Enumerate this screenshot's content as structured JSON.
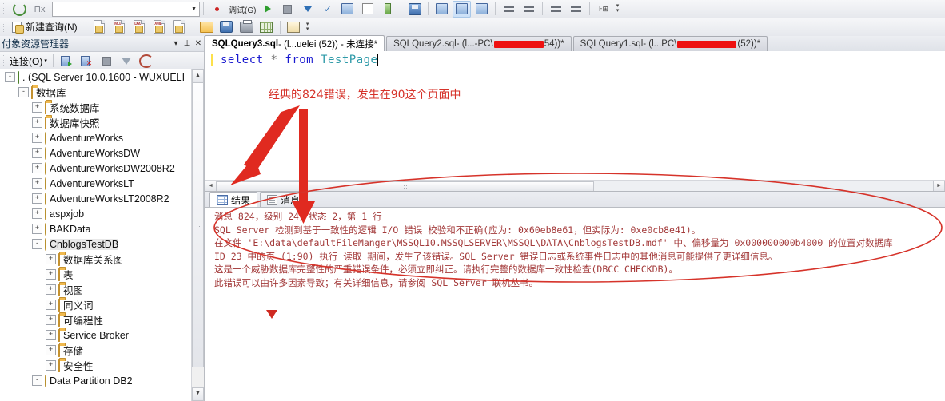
{
  "toolbar_top": {
    "combo_value": "",
    "items": [
      {
        "name": "refresh-icon",
        "glyph": "refresh"
      },
      {
        "name": "debug-stop-icon",
        "glyph": "stop"
      },
      {
        "name": "execute-icon",
        "glyph": "play"
      },
      {
        "name": "check-icon",
        "glyph": "check"
      },
      {
        "name": "plan-icon",
        "glyph": "plan"
      },
      {
        "name": "comment-icon",
        "glyph": "comment"
      },
      {
        "name": "indent-icon",
        "glyph": "indent"
      }
    ]
  },
  "toolbar_main": {
    "new_query_label": "新建查询(N)",
    "buttons": [
      {
        "name": "new-file-button",
        "label": ""
      },
      {
        "name": "new-mdx-query-button",
        "label": "MDX"
      },
      {
        "name": "new-dmx-query-button",
        "label": "DMX"
      },
      {
        "name": "new-xmla-query-button",
        "label": "XML"
      },
      {
        "name": "new-analysis-query-button",
        "label": ""
      },
      {
        "name": "open-file-button",
        "label": ""
      },
      {
        "name": "save-button",
        "label": ""
      },
      {
        "name": "print-button",
        "label": ""
      },
      {
        "name": "query-designer-button",
        "label": ""
      },
      {
        "name": "object-explorer-details-button",
        "label": ""
      }
    ],
    "overflow_label": "▾"
  },
  "explorer": {
    "title": "付象资源管理器",
    "minimize_glyph": "▾",
    "pin_glyph": "⊥",
    "close_glyph": "✕",
    "connect_label": "连接(O)",
    "connect_arrow": "▾",
    "tool_icons": [
      {
        "name": "connect-object-explorer-icon"
      },
      {
        "name": "disconnect-object-explorer-icon"
      },
      {
        "name": "stop-icon"
      },
      {
        "name": "filter-icon"
      },
      {
        "name": "refresh-explorer-icon"
      }
    ],
    "tree": [
      {
        "label": ". (SQL Server 10.0.1600 - WUXUELI",
        "indent": 0,
        "expander": "-",
        "icon": "server-icon",
        "selected": false
      },
      {
        "label": "数据库",
        "indent": 1,
        "expander": "-",
        "icon": "folder-icon",
        "selected": false
      },
      {
        "label": "系统数据库",
        "indent": 2,
        "expander": "+",
        "icon": "folder-icon",
        "selected": false
      },
      {
        "label": "数据库快照",
        "indent": 2,
        "expander": "+",
        "icon": "folder-icon",
        "selected": false
      },
      {
        "label": "AdventureWorks",
        "indent": 2,
        "expander": "+",
        "icon": "database-icon",
        "selected": false
      },
      {
        "label": "AdventureWorksDW",
        "indent": 2,
        "expander": "+",
        "icon": "database-icon",
        "selected": false
      },
      {
        "label": "AdventureWorksDW2008R2",
        "indent": 2,
        "expander": "+",
        "icon": "database-icon",
        "selected": false
      },
      {
        "label": "AdventureWorksLT",
        "indent": 2,
        "expander": "+",
        "icon": "database-icon",
        "selected": false
      },
      {
        "label": "AdventureWorksLT2008R2",
        "indent": 2,
        "expander": "+",
        "icon": "database-icon",
        "selected": false
      },
      {
        "label": "aspxjob",
        "indent": 2,
        "expander": "+",
        "icon": "database-icon",
        "selected": false
      },
      {
        "label": "BAKData",
        "indent": 2,
        "expander": "+",
        "icon": "database-icon",
        "selected": false
      },
      {
        "label": "CnblogsTestDB",
        "indent": 2,
        "expander": "-",
        "icon": "database-icon",
        "selected": true
      },
      {
        "label": "数据库关系图",
        "indent": 3,
        "expander": "+",
        "icon": "folder-icon",
        "selected": false
      },
      {
        "label": "表",
        "indent": 3,
        "expander": "+",
        "icon": "folder-icon",
        "selected": false
      },
      {
        "label": "视图",
        "indent": 3,
        "expander": "+",
        "icon": "folder-icon",
        "selected": false
      },
      {
        "label": "同义词",
        "indent": 3,
        "expander": "+",
        "icon": "folder-icon",
        "selected": false
      },
      {
        "label": "可编程性",
        "indent": 3,
        "expander": "+",
        "icon": "folder-icon",
        "selected": false
      },
      {
        "label": "Service Broker",
        "indent": 3,
        "expander": "+",
        "icon": "folder-icon",
        "selected": false
      },
      {
        "label": "存储",
        "indent": 3,
        "expander": "+",
        "icon": "folder-icon",
        "selected": false
      },
      {
        "label": "安全性",
        "indent": 3,
        "expander": "+",
        "icon": "folder-icon",
        "selected": false
      },
      {
        "label": "Data Partition DB2",
        "indent": 2,
        "expander": "-",
        "icon": "database-icon",
        "selected": false
      }
    ]
  },
  "tabs": [
    {
      "pre": "SQLQuery3.sql",
      "mid": " - (l...uelei (52)) - 未连接*",
      "redact_w": 0,
      "post": "",
      "active": true
    },
    {
      "pre": "SQLQuery2.sql",
      "mid": " - (l...-PC\\",
      "redact_w": 62,
      "post": "54))*",
      "active": false
    },
    {
      "pre": "SQLQuery1.sql",
      "mid": " - (l...PC\\",
      "redact_w": 74,
      "post": " (52))*",
      "active": false
    }
  ],
  "editor": {
    "sql_keyword_select": "select",
    "sql_star": "*",
    "sql_keyword_from": "from",
    "sql_table": "TestPage"
  },
  "result_tabs": [
    {
      "label": "结果",
      "icon": "grid-icon",
      "active": true
    },
    {
      "label": "消息",
      "icon": "message-icon",
      "active": false
    }
  ],
  "messages": [
    "消息 824，级别 24，状态 2，第 1 行",
    "SQL Server 检测到基于一致性的逻辑 I/O 错误 校验和不正确(应为: 0x60eb8e61，但实际为: 0xe0cb8e41)。",
    "在文件 'E:\\data\\defaultFileManger\\MSSQL10.MSSQLSERVER\\MSSQL\\DATA\\CnblogsTestDB.mdf' 中、偏移量为 0x000000000b4000 的位置对数据库",
    "ID 23 中的页 (1:90) 执行 读取 期间，发生了该错误。SQL Server 错误日志或系统事件日志中的其他消息可能提供了更详细信息。",
    "这是一个威胁数据库完整性的严重错误条件，必须立即纠正。请执行完整的数据库一致性检查(DBCC CHECKDB)。",
    "此错误可以由许多因素导致；有关详细信息，请参阅 SQL Server 联机丛书。"
  ],
  "annotation": {
    "text": "经典的824错误，发生在90这个页面中",
    "color": "#d6332a"
  },
  "colors": {
    "annotation_red": "#d6332a",
    "message_red": "#a33a3a",
    "keyword_blue": "#1a1ad0",
    "table_teal": "#2e9aa8",
    "redaction_red": "#ee1111"
  }
}
